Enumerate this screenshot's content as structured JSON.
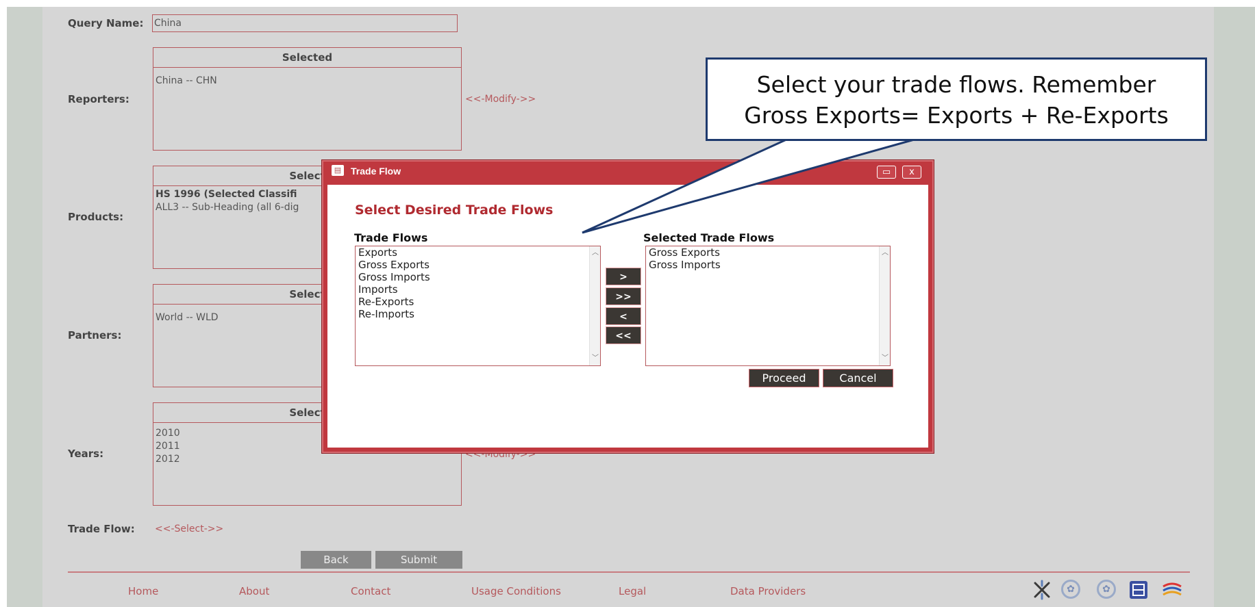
{
  "form": {
    "query_name_label": "Query Name:",
    "query_name_value": "China",
    "reporters_label": "Reporters:",
    "reporters_box_header": "Selected",
    "reporters_items": [
      "China -- CHN"
    ],
    "reporters_modify": "<<-Modify->>",
    "products_label": "Products:",
    "products_box_header": "Select",
    "products_items": [
      "HS 1996 (Selected Classifi",
      "ALL3 -- Sub-Heading (all 6-dig"
    ],
    "partners_label": "Partners:",
    "partners_box_header": "Select",
    "partners_items": [
      "World -- WLD"
    ],
    "years_label": "Years:",
    "years_box_header": "Select",
    "years_items": [
      "2010",
      "2011",
      "2012"
    ],
    "years_modify": "<<-Modify->>",
    "trade_flow_label": "Trade Flow:",
    "trade_flow_select": "<<-Select->>",
    "back_label": "Back",
    "submit_label": "Submit"
  },
  "footer": {
    "links": [
      "Home",
      "About",
      "Contact",
      "Usage Conditions",
      "Legal",
      "Data Providers"
    ]
  },
  "dialog": {
    "title": "Trade Flow",
    "heading": "Select Desired Trade Flows",
    "available_label": "Trade Flows",
    "available_items": [
      "Exports",
      "Gross Exports",
      "Gross Imports",
      "Imports",
      "Re-Exports",
      "Re-Imports"
    ],
    "selected_label": "Selected Trade Flows",
    "selected_items": [
      "Gross Exports",
      "Gross Imports"
    ],
    "move_buttons": [
      ">",
      ">>",
      "<",
      "<<"
    ],
    "proceed_label": "Proceed",
    "cancel_label": "Cancel",
    "restore_icon": "restore-icon",
    "close_icon": "close-icon"
  },
  "callout": {
    "line1": "Select your trade flows. Remember",
    "line2": "Gross Exports= Exports + Re-Exports"
  },
  "colors": {
    "accent": "#b5585c",
    "dialog_frame": "#c0383f",
    "callout_border": "#1e3a6e",
    "button_dark": "#3b3733"
  }
}
